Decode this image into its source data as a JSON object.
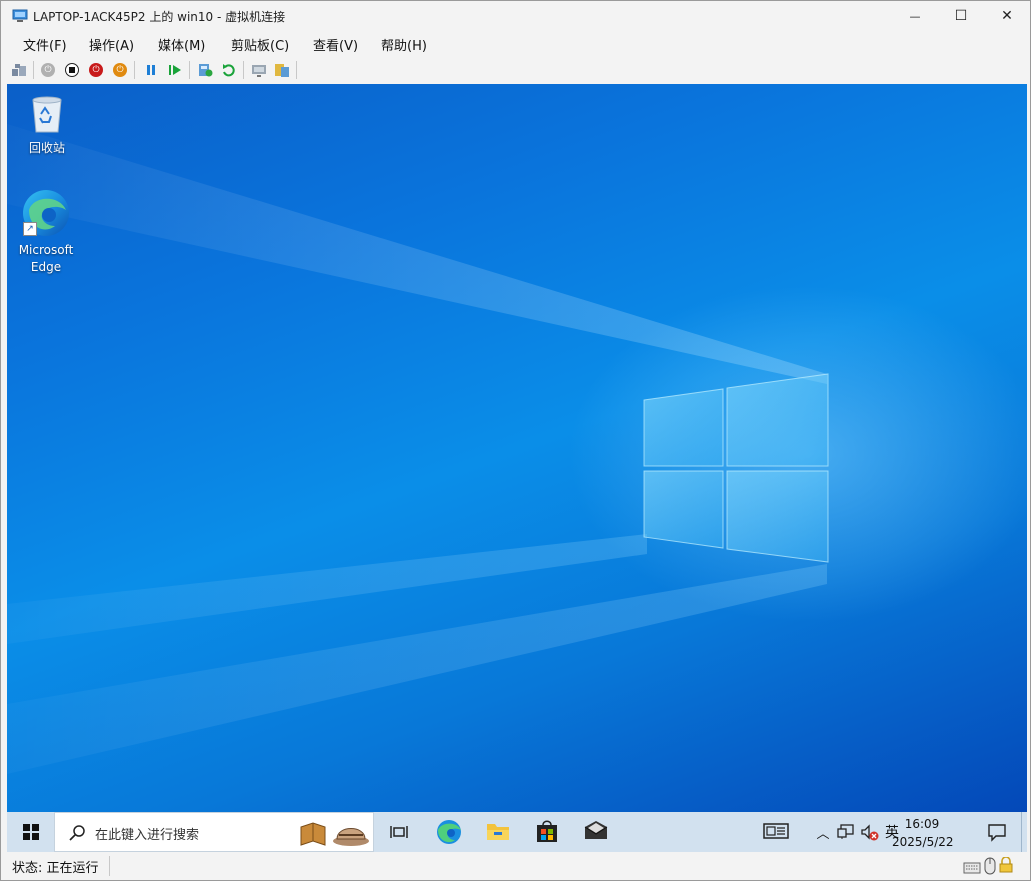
{
  "window": {
    "title": "LAPTOP-1ACK45P2 上的 win10 - 虚拟机连接",
    "minimize_glyph": "—",
    "maximize_glyph": "☐",
    "close_glyph": "✕"
  },
  "menubar": {
    "items": [
      "文件(F)",
      "操作(A)",
      "媒体(M)",
      "剪贴板(C)",
      "查看(V)",
      "帮助(H)"
    ]
  },
  "toolbar": {
    "icons": [
      "ctrl-alt-del-icon",
      "start-icon",
      "turn-off-icon",
      "shutdown-icon",
      "power-icon",
      "pause-icon",
      "resume-icon",
      "checkpoint-icon",
      "revert-icon",
      "enhanced-session-icon",
      "share-icon"
    ]
  },
  "desktop": {
    "icons": [
      {
        "label": "回收站",
        "icon": "recycle-bin-icon"
      },
      {
        "label": "Microsoft Edge",
        "icon": "edge-icon"
      }
    ]
  },
  "taskbar": {
    "search_placeholder": "在此键入进行搜索",
    "pinned": [
      "task-view-icon",
      "edge-icon",
      "file-explorer-icon",
      "store-icon",
      "mail-icon"
    ],
    "ime": "英",
    "time": "16:09",
    "date": "2025/5/22"
  },
  "statusbar": {
    "status": "状态: 正在运行"
  },
  "colors": {
    "desktop_blue": "#0a74dc",
    "taskbar": "#d2e1ef",
    "chrome": "#f3f3f3"
  }
}
